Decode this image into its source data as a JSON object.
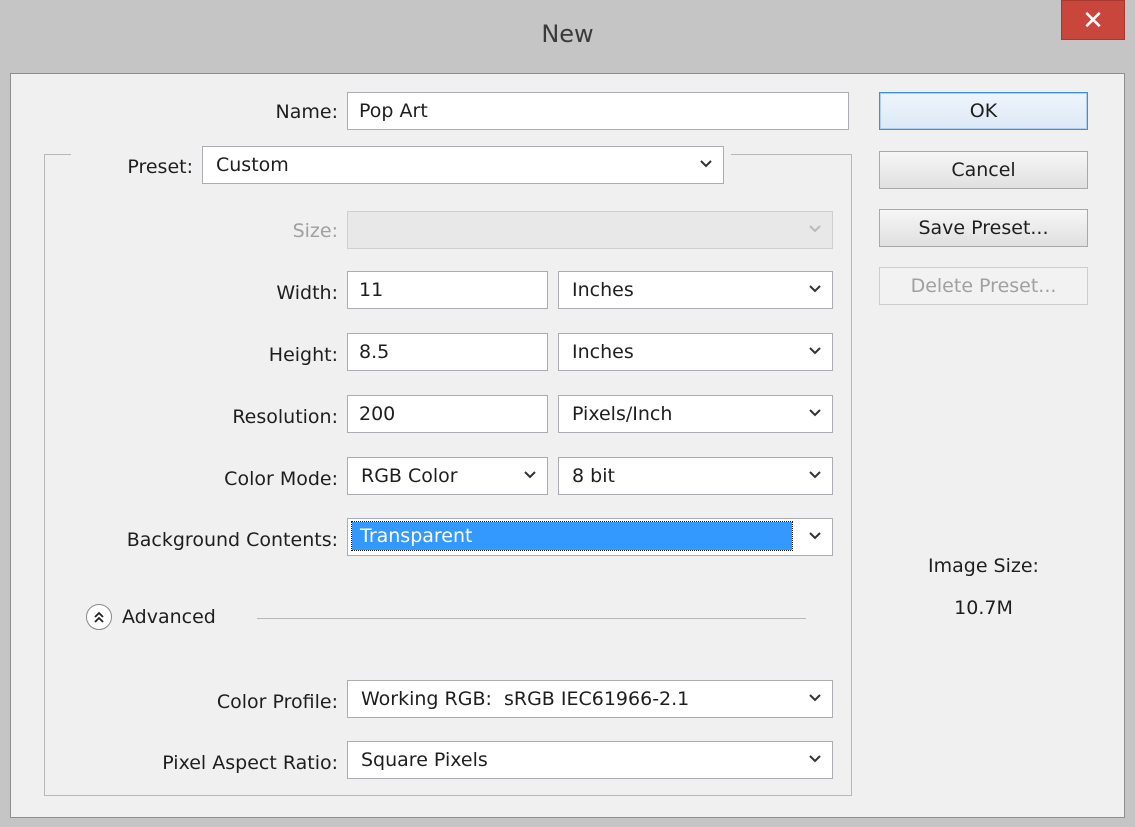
{
  "window": {
    "title": "New",
    "close_glyph": "✕"
  },
  "form": {
    "name_label": "Name:",
    "name_value": "Pop Art",
    "preset_label": "Preset:",
    "preset_value": "Custom",
    "size_label": "Size:",
    "size_value": "",
    "width_label": "Width:",
    "width_value": "11",
    "width_unit": "Inches",
    "height_label": "Height:",
    "height_value": "8.5",
    "height_unit": "Inches",
    "resolution_label": "Resolution:",
    "resolution_value": "200",
    "resolution_unit": "Pixels/Inch",
    "color_mode_label": "Color Mode:",
    "color_mode_value": "RGB Color",
    "bit_depth_value": "8 bit",
    "background_label": "Background Contents:",
    "background_value": "Transparent",
    "advanced_label": "Advanced",
    "color_profile_label": "Color Profile:",
    "color_profile_value": "Working RGB:  sRGB IEC61966-2.1",
    "pixel_aspect_label": "Pixel Aspect Ratio:",
    "pixel_aspect_value": "Square Pixels"
  },
  "buttons": {
    "ok": "OK",
    "cancel": "Cancel",
    "save_preset": "Save Preset...",
    "delete_preset": "Delete Preset..."
  },
  "info": {
    "image_size_label": "Image Size:",
    "image_size_value": "10.7M"
  },
  "colors": {
    "selection": "#3399ff",
    "close": "#c9463d",
    "dialog_bg": "#f0f0f0"
  },
  "icons": [
    "close-icon",
    "chevron-down-icon",
    "collapse-double-chevron-icon"
  ]
}
